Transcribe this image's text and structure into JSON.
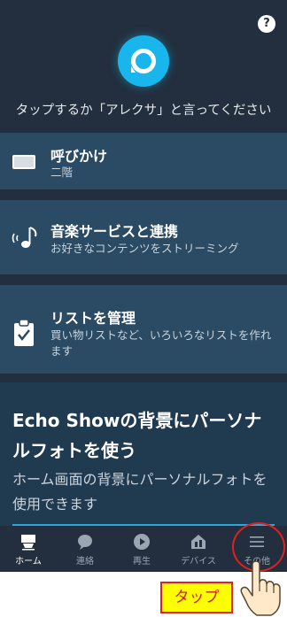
{
  "help": {
    "label": "?"
  },
  "assistant": {
    "prompt": "タップするか「アレクサ」と言ってください"
  },
  "cards": [
    {
      "title": "呼びかけ",
      "subtitle": "二階"
    },
    {
      "title": "音楽サービスと連携",
      "subtitle": "お好きなコンテンツをストリーミング"
    },
    {
      "title": "リストを管理",
      "subtitle": "買い物リストなど、いろいろなリストを作れます"
    }
  ],
  "promo": {
    "heading": "Echo Showの背景にパーソナルフォトを使う",
    "description": "ホーム画面の背景にパーソナルフォトを使用できます"
  },
  "tabs": [
    {
      "label": "ホーム",
      "icon": "echo-show-icon",
      "active": true
    },
    {
      "label": "連絡",
      "icon": "chat-bubble-icon",
      "active": false
    },
    {
      "label": "再生",
      "icon": "play-icon",
      "active": false
    },
    {
      "label": "デバイス",
      "icon": "devices-icon",
      "active": false
    },
    {
      "label": "その他",
      "icon": "menu-icon",
      "active": false
    }
  ],
  "annotation": {
    "tap_label": "タップ",
    "accent": "#e32020",
    "highlight_bg": "#ffff00"
  },
  "colors": {
    "background": "#232f3e",
    "card": "#2b4a63",
    "alexa_blue": "#19b6ee"
  }
}
